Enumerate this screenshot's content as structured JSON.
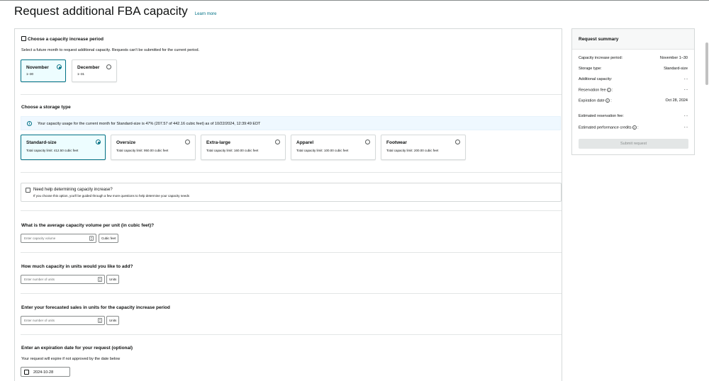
{
  "page": {
    "title": "Request additional FBA capacity",
    "learn_more": "Learn more"
  },
  "period": {
    "title": "Choose a capacity increase period",
    "description": "Select a future month to request additional capacity. Requests can't be submitted for the current period.",
    "options": [
      {
        "month": "November",
        "range": "1–30",
        "selected": true
      },
      {
        "month": "December",
        "range": "1–31",
        "selected": false
      }
    ]
  },
  "storage": {
    "title": "Choose a storage type",
    "alert": "Your capacity usage for the current month for Standard-size is 47% (207.57 of 442.16 cubic feet) as of 10/22/2024, 12:39:49 EDT",
    "options": [
      {
        "name": "Standard-size",
        "limit": "Total capacity limit: 412.50 cubic feet",
        "selected": true
      },
      {
        "name": "Oversize",
        "limit": "Total capacity limit: 950.00 cubic feet",
        "selected": false
      },
      {
        "name": "Extra-large",
        "limit": "Total capacity limit: 160.00 cubic feet",
        "selected": false
      },
      {
        "name": "Apparel",
        "limit": "Total capacity limit: 100.00 cubic feet",
        "selected": false
      },
      {
        "name": "Footwear",
        "limit": "Total capacity limit: 200.00 cubic feet",
        "selected": false
      }
    ]
  },
  "help": {
    "label": "Need help determining capacity increase?",
    "sub": "If you choose this option, you'll be guided through a few more questions to help determine your capacity needs",
    "checked": false
  },
  "volume": {
    "title": "What is the average capacity volume per unit (in cubic feet)?",
    "placeholder": "Enter capacity volume",
    "unit": "Cubic feet"
  },
  "capacity_units": {
    "title": "How much capacity in units would you like to add?",
    "placeholder": "Enter number of units",
    "unit": "Units"
  },
  "forecast": {
    "title": "Enter your forecasted sales in units for the capacity increase period",
    "placeholder": "Enter number of units",
    "unit": "Units"
  },
  "expiration": {
    "title": "Enter an expiration date for your request (optional)",
    "description": "Your request will expire if not approved by the date below",
    "value": "2024-10-28"
  },
  "summary": {
    "title": "Request summary",
    "rows": [
      {
        "label": "Capacity increase period:",
        "value": "November 1–30"
      },
      {
        "label": "Storage type:",
        "value": "Standard-size"
      },
      {
        "label": "Additional capacity:",
        "value": "- -"
      },
      {
        "label": "Reservation fee",
        "value": "- -"
      },
      {
        "label": "Expiration date",
        "value": "Oct 28, 2024"
      },
      {
        "label": "Estimated reservation fee:",
        "value": "- -"
      },
      {
        "label": "Estimated performance credits",
        "value": "- -"
      }
    ],
    "submit": "Submit request"
  },
  "colors": {
    "accent": "#007185",
    "selected_bg": "#edfdff",
    "alert_bg": "#eff8ff"
  }
}
